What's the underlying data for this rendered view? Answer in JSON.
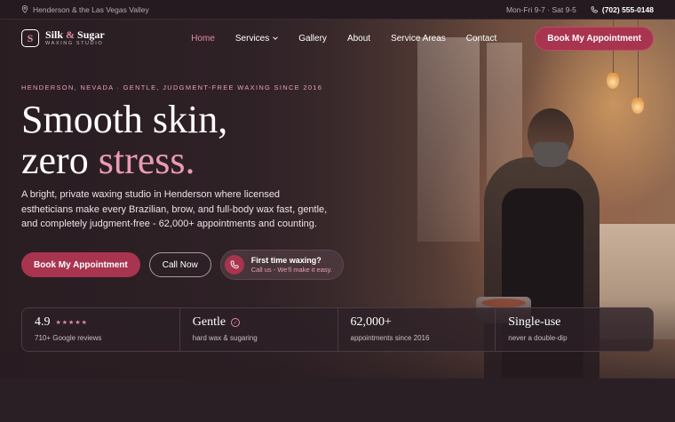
{
  "topbar": {
    "location": "Henderson & the Las Vegas Valley",
    "hours": "Mon-Fri 9-7 · Sat 9-5",
    "phone": "(702) 555-0148"
  },
  "nav": {
    "logo_name_a": "Silk",
    "logo_amp": "&",
    "logo_name_b": "Sugar",
    "logo_sub": "WAXING STUDIO",
    "items": [
      {
        "label": "Home",
        "active": true
      },
      {
        "label": "Services",
        "has_dropdown": true
      },
      {
        "label": "Gallery"
      },
      {
        "label": "About"
      },
      {
        "label": "Service Areas"
      },
      {
        "label": "Contact"
      }
    ],
    "cta": "Book My Appointment"
  },
  "hero": {
    "eyebrow": "HENDERSON, NEVADA · GENTLE, JUDGMENT-FREE WAXING SINCE 2016",
    "title_line1": "Smooth skin,",
    "title_line2a": "zero ",
    "title_line2b": "stress.",
    "lede": "A bright, private waxing studio in Henderson where licensed estheticians make every Brazilian, brow, and full-body wax fast, gentle, and completely judgment-free - 62,000+ appointments and counting.",
    "btn_book": "Book My Appointment",
    "btn_call": "Call Now",
    "first_time_title": "First time waxing?",
    "first_time_sub": "Call us - We'll make it easy."
  },
  "stats": [
    {
      "value": "4.9",
      "stars": "★★★★★",
      "sub": "710+ Google reviews"
    },
    {
      "value": "Gentle",
      "sub": "hard wax & sugaring"
    },
    {
      "value": "62,000+",
      "sub": "appointments since 2016"
    },
    {
      "value": "Single-use",
      "sub": "never a double-dip"
    }
  ],
  "colors": {
    "accent": "#a83450",
    "accent_light": "#e28ba5",
    "background": "#2e2227"
  }
}
